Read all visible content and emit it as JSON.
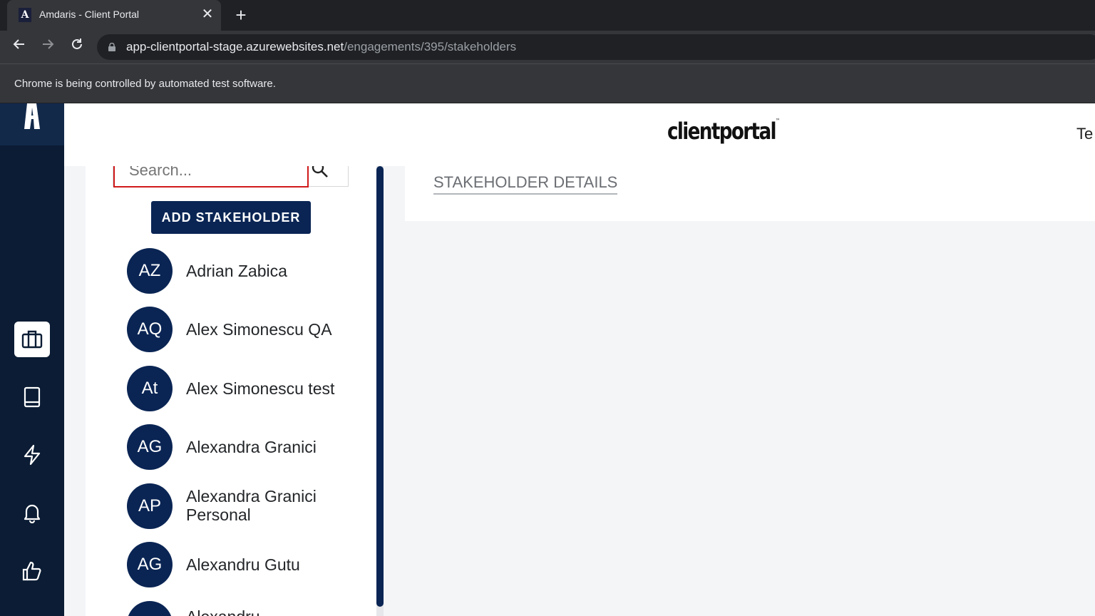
{
  "browser": {
    "tab_title": "Amdaris - Client Portal",
    "favicon_letter": "A",
    "tab_close": "✕",
    "new_tab": "+",
    "url_host": "app-clientportal-stage.azurewebsites.net",
    "url_path": "/engagements/395/stakeholders",
    "infobar": "Chrome is being controlled by automated test software."
  },
  "header": {
    "brand": "clientportal",
    "brand_tm": "™",
    "user_partial": "Te"
  },
  "search": {
    "placeholder": "Search..."
  },
  "add_button_label": "ADD STAKEHOLDER",
  "stakeholders": [
    {
      "initials": "AZ",
      "name": "Adrian Zabica"
    },
    {
      "initials": "AQ",
      "name": "Alex Simonescu QA"
    },
    {
      "initials": "At",
      "name": "Alex Simonescu test"
    },
    {
      "initials": "AG",
      "name": "Alexandra Granici"
    },
    {
      "initials": "AP",
      "name": "Alexandra Granici Personal"
    },
    {
      "initials": "AG",
      "name": "Alexandru Gutu"
    },
    {
      "initials": "",
      "name": "Alexandru"
    }
  ],
  "details_tab": "STAKEHOLDER DETAILS",
  "colors": {
    "navy": "#0a2554",
    "sidebar": "#0b1c34",
    "search_error": "#d0191b"
  }
}
